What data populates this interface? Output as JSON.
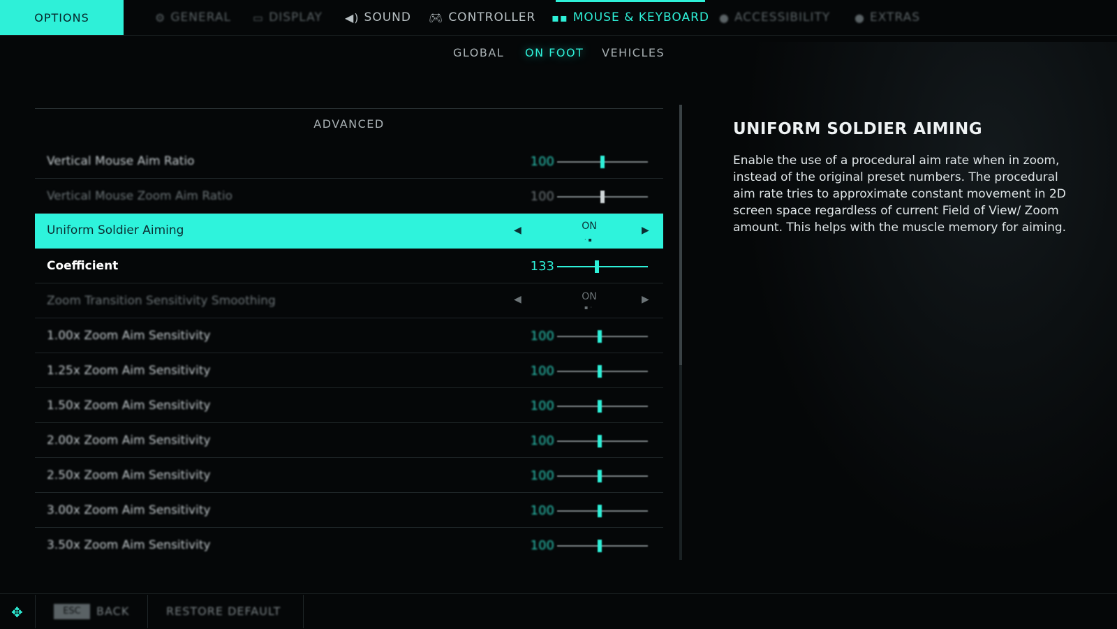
{
  "topbar": {
    "options_label": "OPTIONS",
    "tabs": [
      {
        "label": "GENERAL",
        "icon": "gear-icon"
      },
      {
        "label": "DISPLAY",
        "icon": "monitor-icon"
      },
      {
        "label": "SOUND",
        "icon": "speaker-icon"
      },
      {
        "label": "CONTROLLER",
        "icon": "gamepad-icon"
      },
      {
        "label": "MOUSE & KEYBOARD",
        "icon": "mouse-keyboard-icon"
      },
      {
        "label": "ACCESSIBILITY",
        "icon": "accessibility-icon"
      },
      {
        "label": "EXTRAS",
        "icon": "extras-icon"
      }
    ],
    "active_tab": "MOUSE & KEYBOARD"
  },
  "subtabs": {
    "items": [
      "GLOBAL",
      "ON FOOT",
      "VEHICLES"
    ],
    "active": "ON FOOT"
  },
  "section": {
    "title": "ADVANCED"
  },
  "settings": [
    {
      "label": "Vertical Mouse Aim Ratio",
      "value": "100",
      "slider_fraction": 0.5
    },
    {
      "label": "Vertical Mouse Zoom Aim Ratio",
      "value": "100",
      "slider_fraction": 0.5
    },
    {
      "label": "Uniform Soldier Aiming",
      "value": "ON"
    },
    {
      "label": "Coefficient",
      "value": "133",
      "slider_fraction": 0.44
    },
    {
      "label": "Zoom Transition Sensitivity Smoothing",
      "value": "ON"
    },
    {
      "label": "1.00x Zoom Aim Sensitivity",
      "value": "100",
      "slider_fraction": 0.47
    },
    {
      "label": "1.25x Zoom Aim Sensitivity",
      "value": "100",
      "slider_fraction": 0.47
    },
    {
      "label": "1.50x Zoom Aim Sensitivity",
      "value": "100",
      "slider_fraction": 0.47
    },
    {
      "label": "2.00x Zoom Aim Sensitivity",
      "value": "100",
      "slider_fraction": 0.47
    },
    {
      "label": "2.50x Zoom Aim Sensitivity",
      "value": "100",
      "slider_fraction": 0.47
    },
    {
      "label": "3.00x Zoom Aim Sensitivity",
      "value": "100",
      "slider_fraction": 0.47
    },
    {
      "label": "3.50x Zoom Aim Sensitivity",
      "value": "100",
      "slider_fraction": 0.47
    }
  ],
  "description": {
    "title": "UNIFORM SOLDIER AIMING",
    "body": "Enable the use of a procedural aim rate when in zoom, instead of the original preset numbers. The procedural aim rate tries to approximate constant  movement in 2D screen space regardless of current Field of View/ Zoom amount. This helps with the muscle memory for aiming."
  },
  "footer": {
    "esc_key": "ESC",
    "back_label": "BACK",
    "restore_label": "RESTORE DEFAULT"
  },
  "colors": {
    "accent": "#2ef0d8",
    "background": "#050708"
  }
}
